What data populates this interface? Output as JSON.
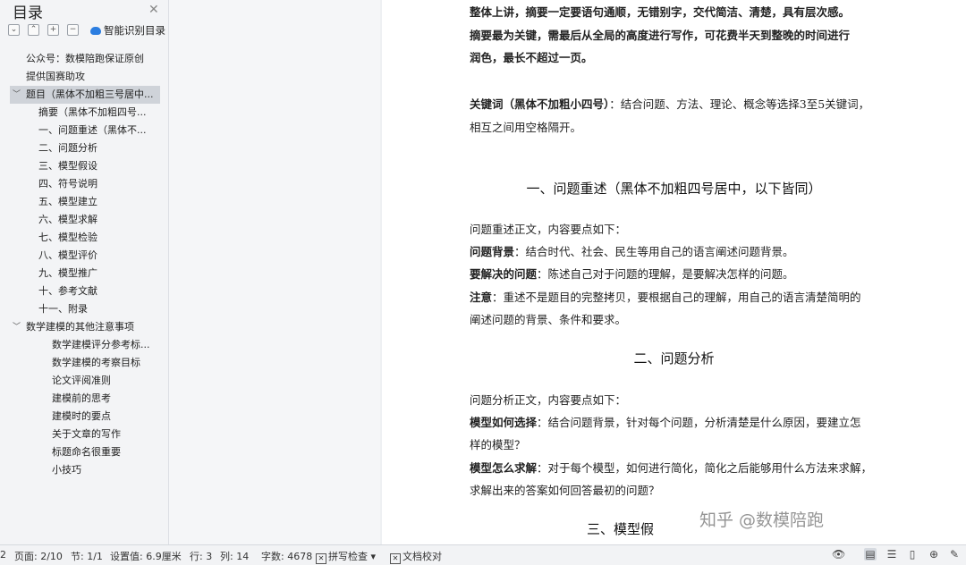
{
  "nav": {
    "title": "目录",
    "smart_toc_label": "智能识别目录",
    "items": [
      {
        "label": "公众号：数模陪跑保证原创",
        "level": 1
      },
      {
        "label": "提供国赛助攻",
        "level": 1
      },
      {
        "label": "题目（黑体不加粗三号居中...",
        "level": 1,
        "expanded": true,
        "selected": true
      },
      {
        "label": "摘要（黑体不加粗四号...",
        "level": 2
      },
      {
        "label": "一、问题重述（黑体不...",
        "level": 2
      },
      {
        "label": "二、问题分析",
        "level": 2
      },
      {
        "label": "三、模型假设",
        "level": 2
      },
      {
        "label": "四、符号说明",
        "level": 2
      },
      {
        "label": "五、模型建立",
        "level": 2
      },
      {
        "label": "六、模型求解",
        "level": 2
      },
      {
        "label": "七、模型检验",
        "level": 2
      },
      {
        "label": "八、模型评价",
        "level": 2
      },
      {
        "label": "九、模型推广",
        "level": 2
      },
      {
        "label": "十、参考文献",
        "level": 2
      },
      {
        "label": "十一、附录",
        "level": 2
      },
      {
        "label": "数学建模的其他注意事项",
        "level": 1,
        "expanded": true
      },
      {
        "label": "数学建模评分参考标...",
        "level": 3
      },
      {
        "label": "数学建模的考察目标",
        "level": 3
      },
      {
        "label": "论文评阅准则",
        "level": 3
      },
      {
        "label": "建模前的思考",
        "level": 3
      },
      {
        "label": "建模时的要点",
        "level": 3
      },
      {
        "label": "关于文章的写作",
        "level": 3
      },
      {
        "label": "标题命名很重要",
        "level": 3
      },
      {
        "label": "小技巧",
        "level": 3
      }
    ]
  },
  "doc": {
    "line1": "整体上讲，摘要一定要语句通顺，无错别字，交代简洁、清楚，具有层次感。",
    "line2": "摘要最为关键，需最后从全局的高度进行写作，可花费半天到整晚的时间进行",
    "line3": "润色，最长不超过一页。",
    "kw_bold": "关键词（黑体不加粗小四号）",
    "kw_text": "：结合问题、方法、理论、概念等选择3至5关键词，",
    "kw_line2": "相互之间用空格隔开。",
    "h1": "一、问题重述（黑体不加粗四号居中，以下皆同）",
    "s1_intro": "问题重述正文，内容要点如下：",
    "s1_a_bold": "问题背景",
    "s1_a_text": "：结合时代、社会、民生等用自己的语言阐述问题背景。",
    "s1_b_bold": "要解决的问题",
    "s1_b_text": "：陈述自己对于问题的理解，是要解决怎样的问题。",
    "s1_c_bold": "注意",
    "s1_c_text": "：重述不是题目的完整拷贝，要根据自己的理解，用自己的语言清楚简明的",
    "s1_c_line2": "阐述问题的背景、条件和要求。",
    "h2": "二、问题分析",
    "s2_intro": "问题分析正文，内容要点如下：",
    "s2_a_bold": "模型如何选择",
    "s2_a_text": "：结合问题背景，针对每个问题，分析清楚是什么原因，要建立怎",
    "s2_a_line2": "样的模型？",
    "s2_b_bold": "模型怎么求解",
    "s2_b_text": "：对于每个模型，如何进行简化，简化之后能够用什么方法来求解，",
    "s2_b_line2": "求解出来的答案如何回答最初的问题？",
    "h3": "三、模型假",
    "watermark": "知乎 @数模陪跑"
  },
  "status": {
    "edge": "2",
    "page": "页面: 2/10",
    "section": "节: 1/1",
    "setting": "设置值: 6.9厘米",
    "row": "行: 3",
    "col": "列: 14",
    "words": "字数: 4678",
    "spell": "拼写检查",
    "proof": "文档校对"
  },
  "colors": {
    "accent": "#2b7de0",
    "selection": "#cfd3d9"
  }
}
